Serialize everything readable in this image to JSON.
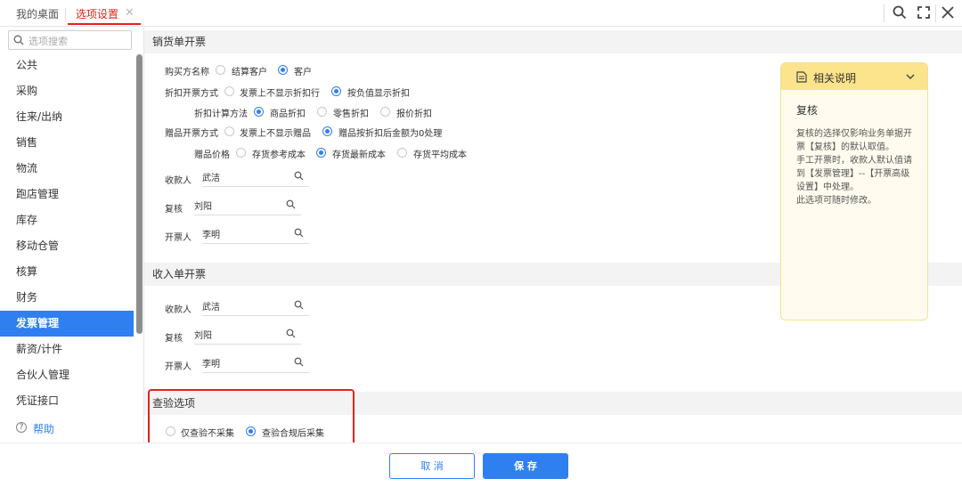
{
  "tabs": [
    {
      "label": "我的桌面"
    },
    {
      "label": "选项设置"
    }
  ],
  "icons": {
    "search": "search-icon",
    "expand": "expand-icon",
    "close": "close-icon"
  },
  "colors": {
    "accent": "#2f7ff1",
    "tab_active": "#e2231a",
    "highlight_box": "#e2231a",
    "help_panel_header": "#fbe48c"
  },
  "sidebar": {
    "search_placeholder": "选项搜索",
    "items": [
      {
        "label": "公共"
      },
      {
        "label": "采购"
      },
      {
        "label": "往来/出纳"
      },
      {
        "label": "销售"
      },
      {
        "label": "物流"
      },
      {
        "label": "跑店管理"
      },
      {
        "label": "库存"
      },
      {
        "label": "移动仓管"
      },
      {
        "label": "核算"
      },
      {
        "label": "财务"
      },
      {
        "label": "发票管理",
        "active": true
      },
      {
        "label": "薪资/计件"
      },
      {
        "label": "合伙人管理"
      },
      {
        "label": "凭证接口"
      }
    ],
    "help_label": "帮助"
  },
  "sales_invoice": {
    "title": "销货单开票",
    "buyer_name": {
      "label": "购买方名称",
      "options": [
        "结算客户",
        "客户"
      ],
      "selected": "客户"
    },
    "discount_mode": {
      "label": "折扣开票方式",
      "options": [
        "发票上不显示折扣行",
        "按负值显示折扣"
      ],
      "selected": "按负值显示折扣"
    },
    "discount_calc": {
      "label": "折扣计算方法",
      "options": [
        "商品折扣",
        "零售折扣",
        "报价折扣"
      ],
      "selected": "商品折扣"
    },
    "gift_mode": {
      "label": "赠品开票方式",
      "options": [
        "发票上不显示赠品",
        "赠品按折扣后金额为0处理"
      ],
      "selected": "赠品按折扣后金额为0处理"
    },
    "gift_price": {
      "label": "赠品价格",
      "options": [
        "存货参考成本",
        "存货最新成本",
        "存货平均成本"
      ],
      "selected": "存货最新成本"
    },
    "payee": {
      "label": "收款人",
      "value": "武洁"
    },
    "reviewer": {
      "label": "复核",
      "value": "刘阳"
    },
    "drawer": {
      "label": "开票人",
      "value": "李明"
    }
  },
  "receipt_invoice": {
    "title": "收入单开票",
    "payee": {
      "label": "收款人",
      "value": "武洁"
    },
    "reviewer": {
      "label": "复核",
      "value": "刘阳"
    },
    "drawer": {
      "label": "开票人",
      "value": "李明"
    }
  },
  "verify": {
    "title": "查验选项",
    "options": [
      "仅查验不采集",
      "查验合规后采集"
    ],
    "selected": "查验合规后采集"
  },
  "help_panel": {
    "header": "相关说明",
    "title": "复核",
    "lines": [
      "复核的选择仅影响业务单据开",
      "票【复核】的默认取值。",
      "手工开票时，收款人默认值请",
      "到【发票管理】--【开票高级",
      "设置】中处理。",
      "此选项可随时修改。"
    ]
  },
  "footer": {
    "cancel": "取 消",
    "save": "保 存"
  }
}
